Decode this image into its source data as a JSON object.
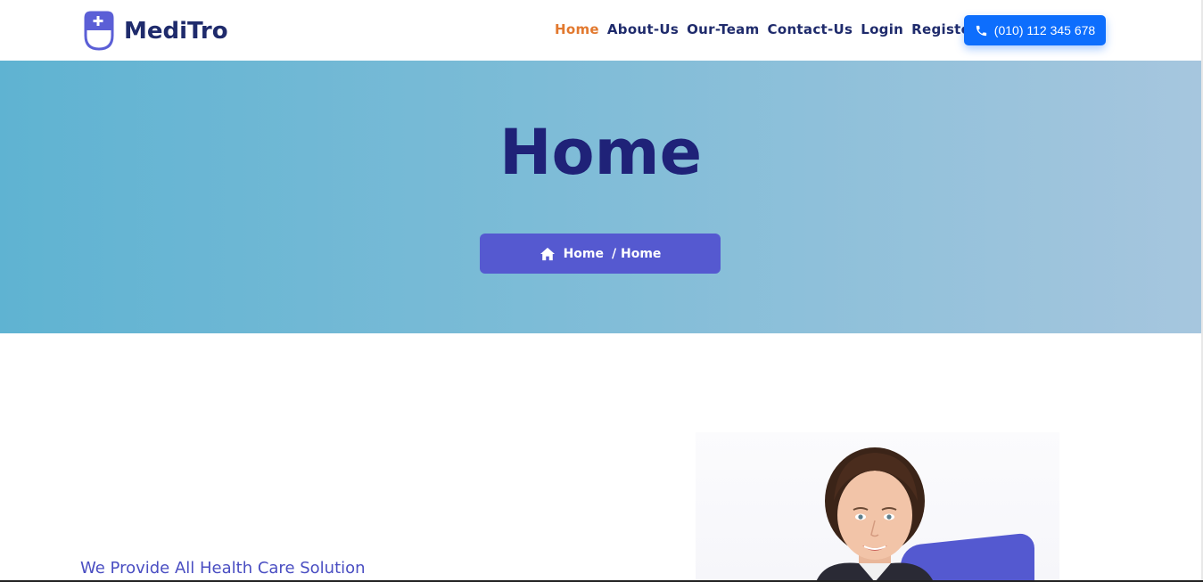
{
  "brand": {
    "name": "MediTro"
  },
  "nav": {
    "items": [
      "Home",
      "About-Us",
      "Our-Team",
      "Contact-Us",
      "Login",
      "Register"
    ],
    "active": "Home"
  },
  "phone": {
    "label": "(010) 112 345 678",
    "icon": "phone-icon"
  },
  "hero": {
    "title": "Home",
    "breadcrumb": {
      "home_label": "Home",
      "current": "/ Home",
      "icon": "home-icon"
    }
  },
  "content": {
    "tagline": "We Provide All Health Care Solution"
  },
  "colors": {
    "navy": "#1f2b6c",
    "accent_orange": "#e2792f",
    "phone_blue": "#0d6efd",
    "breadcrumb_purple": "#5559d0"
  }
}
